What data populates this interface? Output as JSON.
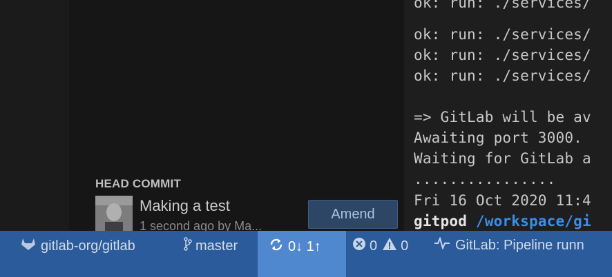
{
  "terminal": {
    "lines": [
      "ok: run: ./services/",
      "ok: run: ./services/",
      "ok: run: ./services/",
      "ok: run: ./services/",
      "=> GitLab will be av",
      "Awaiting port 3000.",
      "Waiting for GitLab a",
      "................",
      "Fri 16 Oct 2020 11:4"
    ],
    "prompt_user": "gitpod",
    "prompt_path": "/workspace/gi"
  },
  "commit": {
    "section_label": "HEAD COMMIT",
    "title": "Making a test",
    "meta": "1 second ago by Ma...",
    "amend_label": "Amend"
  },
  "statusbar": {
    "repo": "gitlab-org/gitlab",
    "branch": "master",
    "sync": "0↓ 1↑",
    "errors": "0",
    "warnings": "0",
    "pipeline": "GitLab: Pipeline runn"
  },
  "colors": {
    "statusbar_bg": "#2b5b9a",
    "sync_highlight": "#4f88cf",
    "terminal_path": "#3b8eea"
  }
}
